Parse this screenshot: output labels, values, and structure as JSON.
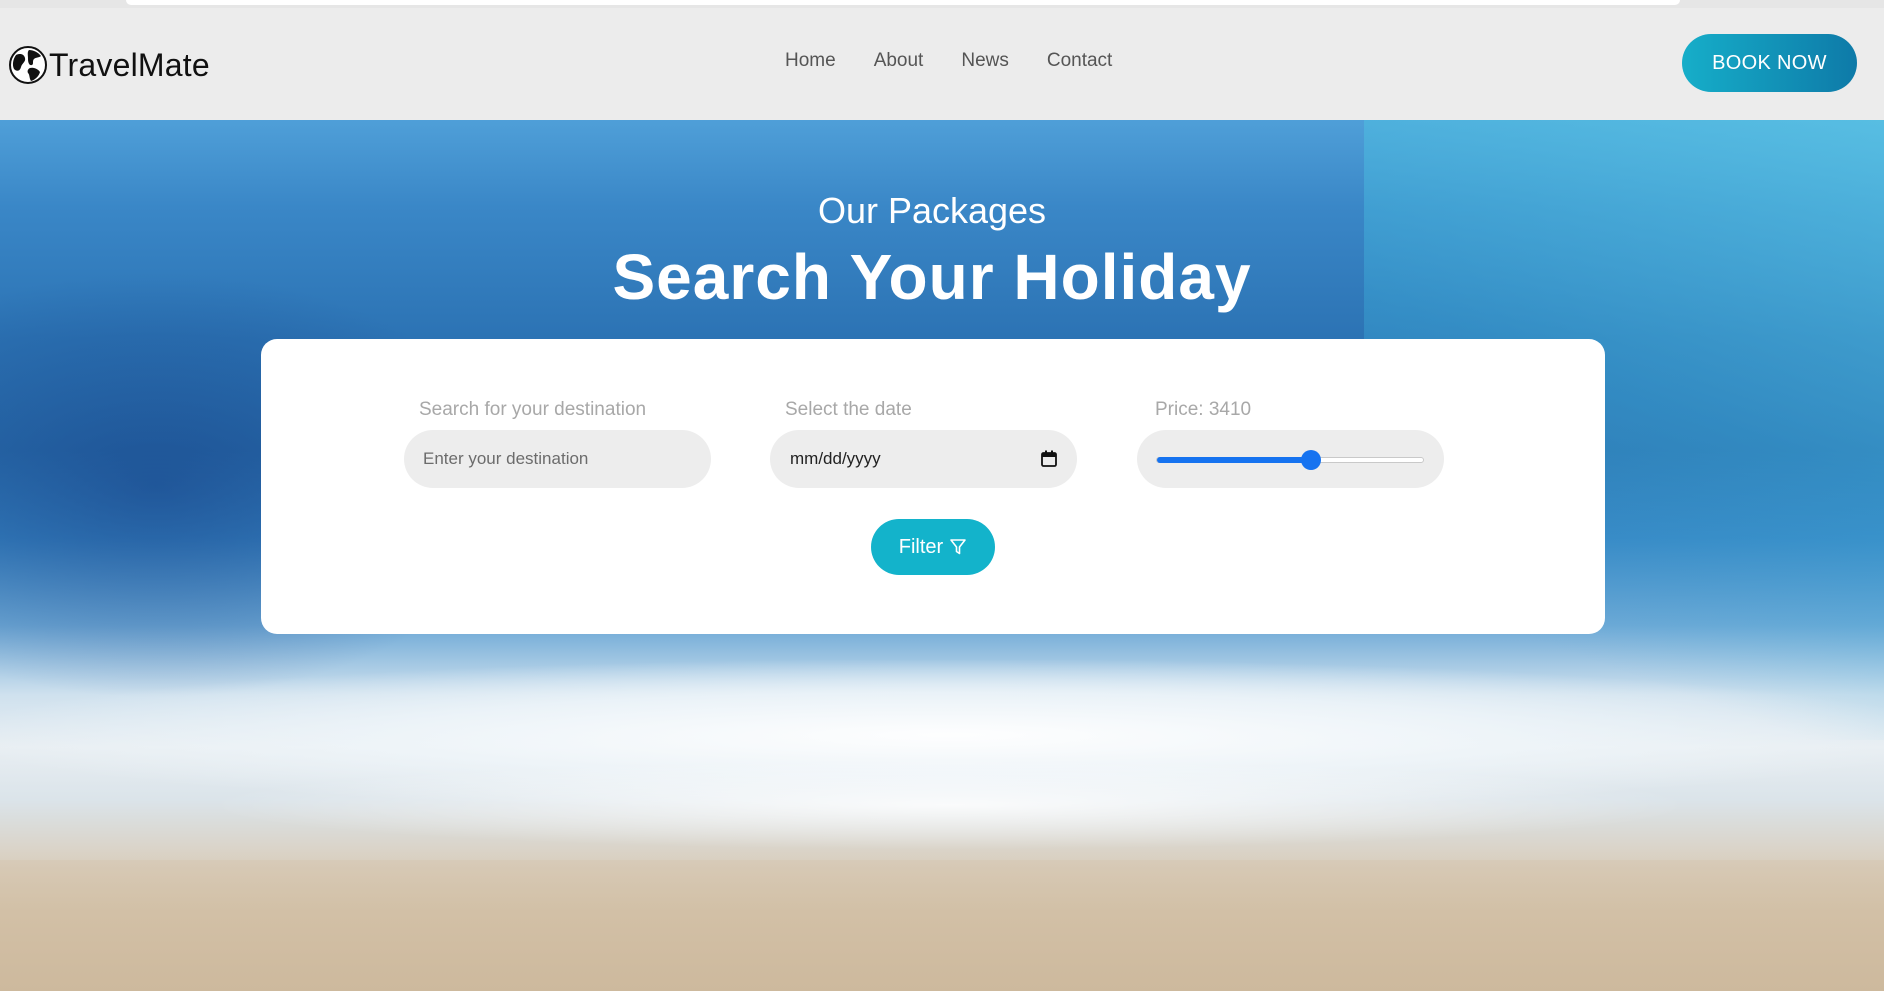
{
  "brand": {
    "name": "TravelMate",
    "icon": "globe-icon"
  },
  "nav": {
    "items": [
      {
        "label": "Home"
      },
      {
        "label": "About"
      },
      {
        "label": "News"
      },
      {
        "label": "Contact"
      }
    ],
    "cta_label": "BOOK NOW"
  },
  "hero": {
    "subtitle": "Our Packages",
    "title": "Search Your Holiday"
  },
  "search": {
    "destination_label": "Search for your destination",
    "destination_placeholder": "Enter your destination",
    "date_label": "Select the date",
    "date_value": "mm/dd/yyyy",
    "price_label": "Price: 3410",
    "price_fraction": 0.58,
    "filter_label": "Filter",
    "filter_icon": "filter-funnel-icon"
  },
  "colors": {
    "accent": "#13b3cb",
    "cta_gradient_start": "#16aec9",
    "cta_gradient_end": "#0e7aa8",
    "slider": "#1673f0"
  }
}
